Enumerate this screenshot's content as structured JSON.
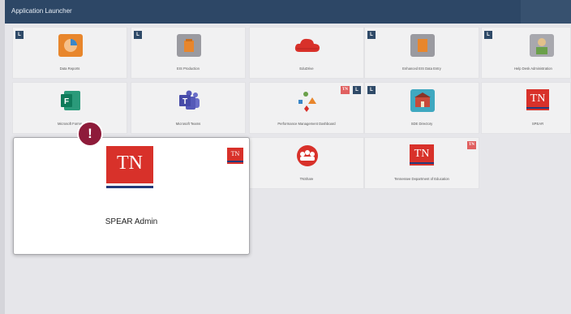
{
  "header": {
    "title": "Application Launcher"
  },
  "badges": {
    "l": "L",
    "tn": "TN"
  },
  "tiles": [
    {
      "label": "Data Reports"
    },
    {
      "label": "EIS Production"
    },
    {
      "label": "EduDrive"
    },
    {
      "label": "Enhanced EIS Data Entry"
    },
    {
      "label": "Help Desk Administration"
    },
    {
      "label": "Microsoft Forms"
    },
    {
      "label": "Microsoft Teams"
    },
    {
      "label": "Performance Management Dashboard"
    },
    {
      "label": "SDE Directory"
    },
    {
      "label": "SPEAR"
    },
    {
      "label": "TNShare"
    },
    {
      "label": "Tennessee Department of Education"
    }
  ],
  "popup": {
    "name": "SPEAR Admin",
    "logo_text": "TN"
  },
  "alert": {
    "symbol": "!"
  },
  "colors": {
    "header": "#2d4766",
    "tn_red": "#d8312a",
    "alert": "#8e1b3a",
    "badge_l": "#2f4a68"
  },
  "icons": [
    "data-reports-icon",
    "eis-production-icon",
    "cloud-icon",
    "data-entry-icon",
    "help-desk-icon",
    "forms-icon",
    "teams-icon",
    "shapes-icon",
    "directory-icon",
    "tn-logo-icon",
    "tnshare-icon",
    "tn-logo-icon"
  ]
}
